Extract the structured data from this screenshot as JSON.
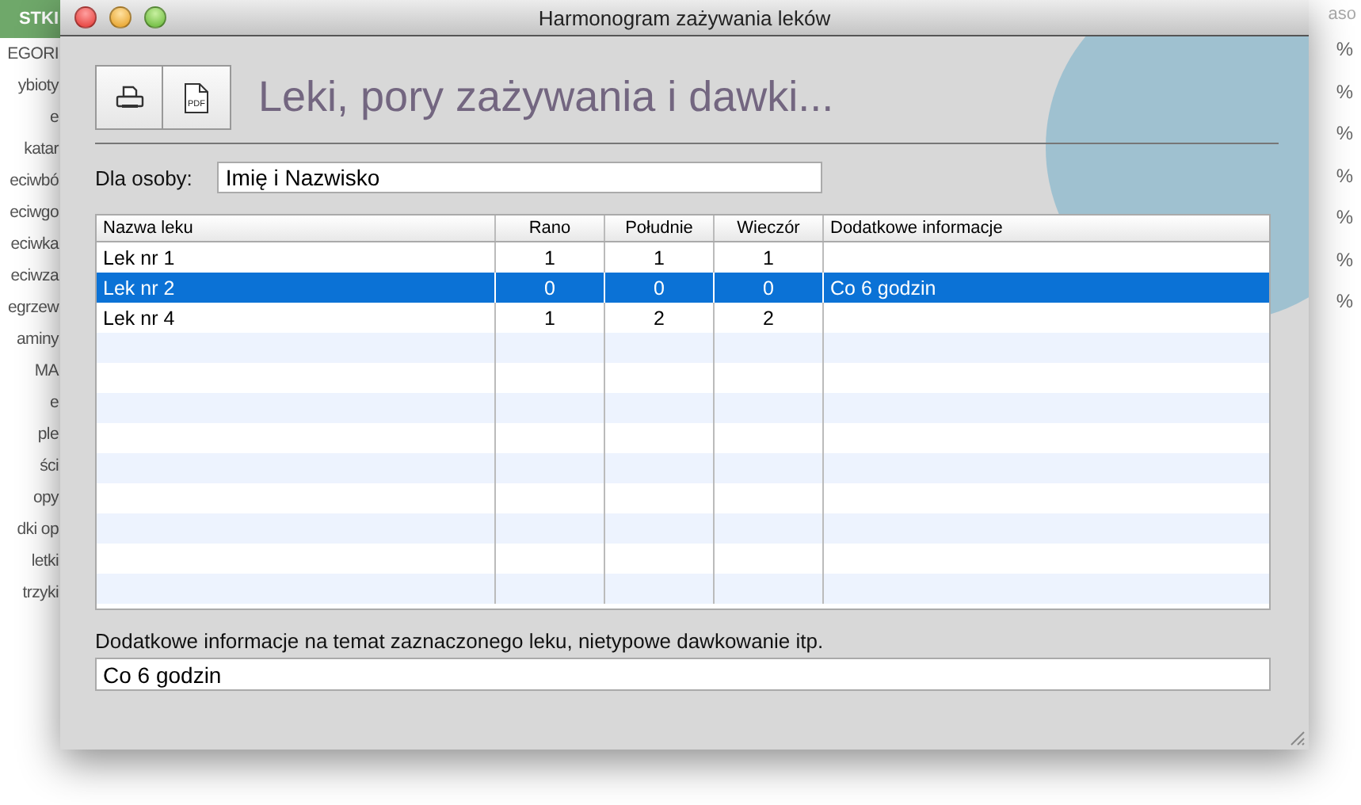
{
  "background_app": {
    "header": "STKI",
    "column_header": "aso",
    "sidebar_items": [
      "EGORI",
      "ybioty",
      "e",
      "katar",
      "eciwbó",
      "eciwgo",
      "eciwka",
      "eciwza",
      "egrzew",
      "aminy",
      "MA",
      "e",
      "ple",
      "ści",
      "opy",
      "dki op",
      "letki",
      "trzyki"
    ],
    "percent_cells": [
      "%",
      "%",
      "%",
      "%",
      "%",
      "%",
      "%"
    ]
  },
  "window": {
    "title": "Harmonogram zażywania leków"
  },
  "toolbar": {
    "buttons": [
      {
        "kind": "print"
      },
      {
        "kind": "pdf",
        "label": "PDF"
      }
    ]
  },
  "heading": "Leki, pory zażywania i dawki...",
  "person": {
    "label": "Dla osoby:",
    "value": "Imię i Nazwisko"
  },
  "table": {
    "columns": [
      "Nazwa leku",
      "Rano",
      "Południe",
      "Wieczór",
      "Dodatkowe informacje"
    ],
    "rows": [
      {
        "cells": [
          "Lek nr 1",
          "1",
          "1",
          "1",
          ""
        ],
        "selected": false
      },
      {
        "cells": [
          "Lek nr 2",
          "0",
          "0",
          "0",
          "Co 6 godzin"
        ],
        "selected": true
      },
      {
        "cells": [
          "Lek nr 4",
          "1",
          "2",
          "2",
          ""
        ],
        "selected": false
      }
    ]
  },
  "notes": {
    "label": "Dodatkowe informacje na temat zaznaczonego leku, nietypowe dawkowanie itp.",
    "value": "Co 6 godzin"
  }
}
